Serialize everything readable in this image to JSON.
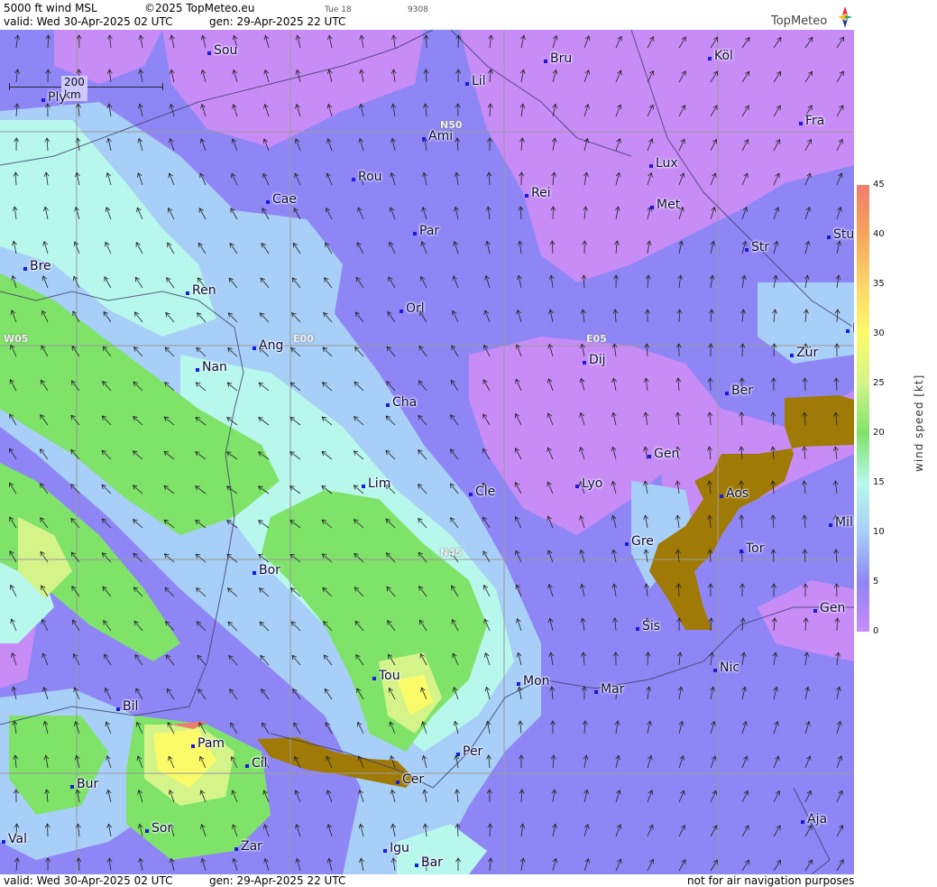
{
  "header": {
    "product": "5000 ft wind MSL",
    "copyright": "©2025 TopMeteo.eu",
    "valid_line": "valid:  Wed  30-Apr-2025  02 UTC",
    "gen_line": "gen: 29-Apr-2025 22 UTC",
    "small_a": "Tue 18",
    "small_b": "9308"
  },
  "logo": {
    "text": "TopMeteo"
  },
  "scale_bar": {
    "label": "200 km"
  },
  "grid_labels": [
    "N50",
    "E00",
    "E05",
    "W05",
    "N45"
  ],
  "cities": [
    "Sou",
    "Bru",
    "Köl",
    "Lil",
    "Ply",
    "Ami",
    "Fra",
    "Lux",
    "Rou",
    "Cae",
    "Rei",
    "Met",
    "Par",
    "Stu",
    "Str",
    "Bre",
    "Ren",
    "Orl",
    "F",
    "Ang",
    "Dij",
    "Zür",
    "Nan",
    "Ber",
    "Cha",
    "Gen",
    "Lim",
    "Cle",
    "Aos",
    "Lyo",
    "Mil",
    "Gre",
    "Tor",
    "Bor",
    "Gen",
    "Sis",
    "Nic",
    "Tou",
    "Mon",
    "Mar",
    "Bil",
    "Pam",
    "Cil",
    "Per",
    "Cer",
    "Bur",
    "Sor",
    "Aja",
    "Zar",
    "Val",
    "Igu",
    "Bar"
  ],
  "legend": {
    "title": "wind speed [kt]",
    "ticks": [
      "45",
      "40",
      "35",
      "30",
      "25",
      "20",
      "15",
      "10",
      "5",
      "0"
    ],
    "colors": [
      "#ef7d6b",
      "#f6a55c",
      "#fbd56a",
      "#fbfb6a",
      "#d4f48a",
      "#7fe36a",
      "#b8f7ec",
      "#a8cff7",
      "#8f86f5",
      "#c88cf7"
    ]
  },
  "footer": {
    "valid_line": "valid:  Wed  30-Apr-2025  02 UTC",
    "gen_line": "gen: 29-Apr-2025 22 UTC",
    "disclaimer": "not for air navigation purposes"
  }
}
